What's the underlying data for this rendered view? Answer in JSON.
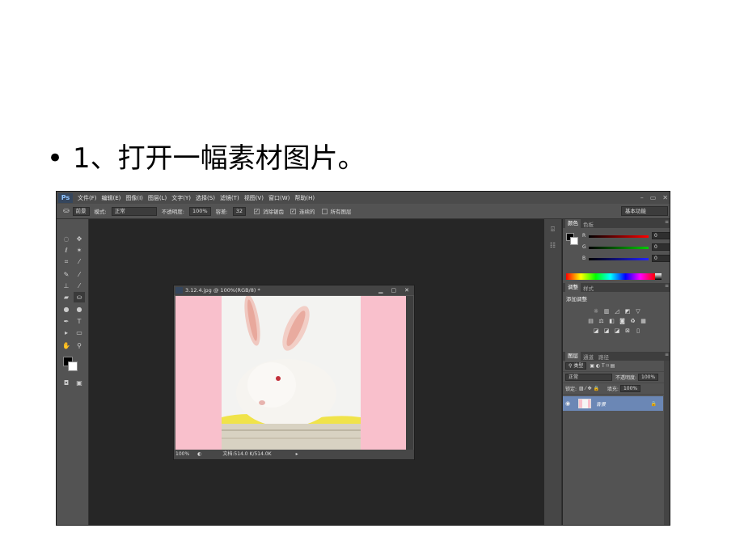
{
  "slide": {
    "bullet": "•",
    "title": "1、打开一幅素材图片。"
  },
  "menubar": {
    "logo": "Ps",
    "items": [
      "文件(F)",
      "编辑(E)",
      "图像(I)",
      "图层(L)",
      "文字(Y)",
      "选择(S)",
      "滤镜(T)",
      "视图(V)",
      "窗口(W)",
      "帮助(H)"
    ],
    "window_controls": [
      "–",
      "▭",
      "✕"
    ]
  },
  "options_bar": {
    "preset": "前景",
    "mode_label": "模式:",
    "mode_value": "正常",
    "opacity_label": "不透明度:",
    "opacity_value": "100%",
    "tolerance_label": "容差:",
    "tolerance_value": "32",
    "antialias_label": "消除锯齿",
    "contiguous_label": "连续的",
    "all_layers_label": "所有图层",
    "workspace": "基本功能"
  },
  "document": {
    "title": "3.12.4.jpg @ 100%(RGB/8) *",
    "controls": [
      "▁",
      "▢",
      "✕"
    ],
    "zoom": "100%",
    "docinfo": "文档:514.0 K/514.0K"
  },
  "panels": {
    "color": {
      "tabs": [
        "颜色",
        "色板"
      ],
      "channels": [
        {
          "label": "R",
          "value": "0",
          "color": "#d02020"
        },
        {
          "label": "G",
          "value": "0",
          "color": "#20b020"
        },
        {
          "label": "B",
          "value": "0",
          "color": "#2040d0"
        }
      ]
    },
    "adjustments": {
      "tabs": [
        "调整",
        "样式"
      ],
      "title": "添加调整"
    },
    "layers": {
      "tabs": [
        "图层",
        "通道",
        "路径"
      ],
      "kind_filter": "类型",
      "blend_mode": "正常",
      "opacity_label": "不透明度:",
      "opacity_value": "100%",
      "lock_label": "锁定:",
      "fill_label": "填充:",
      "fill_value": "100%",
      "layer_name": "背景",
      "footer_icons": [
        "∞",
        "fx",
        "◘",
        "◐",
        "▭",
        "▣",
        "🗑"
      ]
    }
  }
}
